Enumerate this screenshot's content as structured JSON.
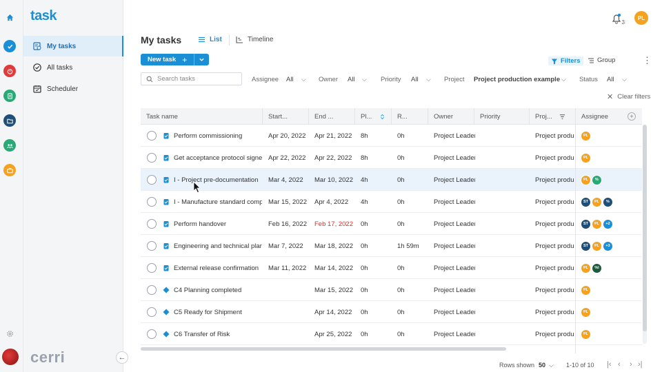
{
  "app": {
    "logo": "task",
    "brand": "cerri"
  },
  "rail": {
    "icons": [
      "home-icon",
      "check-circle-icon",
      "timer-icon",
      "document-icon",
      "folder-icon",
      "team-icon",
      "briefcase-icon",
      "settings-icon"
    ]
  },
  "sidebar": {
    "items": [
      {
        "label": "My tasks",
        "icon": "my-tasks-icon",
        "active": true
      },
      {
        "label": "All tasks",
        "icon": "check-circle-icon",
        "active": false
      },
      {
        "label": "Scheduler",
        "icon": "calendar-icon",
        "active": false
      }
    ],
    "collapse_icon": "←"
  },
  "header": {
    "title": "My tasks",
    "tabs": [
      {
        "label": "List",
        "active": true
      },
      {
        "label": "Timeline",
        "active": false
      }
    ],
    "notification_count": "3",
    "user_initials": "PL",
    "new_task_label": "New task",
    "new_task_plus": "+",
    "filters_label": "Filters",
    "group_label": "Group",
    "more_icon": "⋮"
  },
  "filters": {
    "search_placeholder": "Search tasks",
    "assignee": {
      "label": "Assignee",
      "value": "All"
    },
    "owner": {
      "label": "Owner",
      "value": "All"
    },
    "priority": {
      "label": "Priority",
      "value": "All"
    },
    "project": {
      "label": "Project",
      "value": "Project production example"
    },
    "status": {
      "label": "Status",
      "value": "All"
    },
    "clear_label": "Clear filters",
    "clear_icon": "✕",
    "chevron": "⌵"
  },
  "table": {
    "columns": [
      "Task name",
      "Start...",
      "End ...",
      "Pl...",
      "R...",
      "Owner",
      "Priority",
      "Proj...",
      "Assignee"
    ],
    "rows": [
      {
        "type": "task",
        "name": "Perform commissioning",
        "start": "Apr 20, 2022",
        "end": "Apr 21, 2022",
        "end_red": false,
        "planned": "8h",
        "remaining": "0h",
        "owner": "Project Leader",
        "priority": "",
        "project": "Project production example",
        "assignees": [
          {
            "i": "PL",
            "c": "#f4a21f"
          }
        ]
      },
      {
        "type": "task",
        "name": "Get acceptance protocol signed",
        "start": "Apr 22, 2022",
        "end": "Apr 22, 2022",
        "end_red": false,
        "planned": "8h",
        "remaining": "0h",
        "owner": "Project Leader",
        "priority": "",
        "project": "Project production example",
        "assignees": [
          {
            "i": "PL",
            "c": "#f4a21f"
          }
        ]
      },
      {
        "type": "task",
        "name": "I - Project pre-documentation",
        "start": "Mar 4, 2022",
        "end": "Mar 10, 2022",
        "end_red": false,
        "planned": "4h",
        "remaining": "0h",
        "owner": "Project Leader",
        "priority": "",
        "project": "Project production example",
        "assignees": [
          {
            "i": "PL",
            "c": "#f4a21f"
          },
          {
            "i": "%",
            "c": "#2aa876"
          }
        ]
      },
      {
        "type": "task",
        "name": "I - Manufacture standard components",
        "start": "Mar 15, 2022",
        "end": "Apr 4, 2022",
        "end_red": false,
        "planned": "4h",
        "remaining": "0h",
        "owner": "Project Leader",
        "priority": "",
        "project": "Project production example",
        "assignees": [
          {
            "i": "ST",
            "c": "#1f4e79"
          },
          {
            "i": "PL",
            "c": "#f4a21f"
          },
          {
            "i": "%",
            "c": "#1f4e79"
          }
        ]
      },
      {
        "type": "task",
        "name": "Perform handover",
        "start": "Feb 16, 2022",
        "end": "Feb 17, 2022",
        "end_red": true,
        "planned": "0h",
        "remaining": "0h",
        "owner": "Project Leader",
        "priority": "",
        "project": "Project production example",
        "assignees": [
          {
            "i": "ST",
            "c": "#1f4e79"
          },
          {
            "i": "PL",
            "c": "#f4a21f"
          },
          {
            "i": "+2",
            "c": "#1a8fd6"
          }
        ]
      },
      {
        "type": "task",
        "name": "Engineering and technical planning",
        "start": "Mar 7, 2022",
        "end": "Mar 18, 2022",
        "end_red": false,
        "planned": "0h",
        "remaining": "1h 59m",
        "owner": "Project Leader",
        "priority": "",
        "project": "Project production example",
        "assignees": [
          {
            "i": "ST",
            "c": "#1f4e79"
          },
          {
            "i": "PL",
            "c": "#f4a21f"
          },
          {
            "i": "+3",
            "c": "#1a8fd6"
          }
        ]
      },
      {
        "type": "task",
        "name": "External release confirmation",
        "start": "Mar 11, 2022",
        "end": "Mar 14, 2022",
        "end_red": false,
        "planned": "0h",
        "remaining": "0h",
        "owner": "Project Leader",
        "priority": "",
        "project": "Project production example",
        "assignees": [
          {
            "i": "PL",
            "c": "#f4a21f"
          },
          {
            "i": "%I",
            "c": "#1e5a3c"
          }
        ]
      },
      {
        "type": "milestone",
        "name": "C4 Planning completed",
        "start": "",
        "end": "Mar 15, 2022",
        "end_red": false,
        "planned": "0h",
        "remaining": "0h",
        "owner": "Project Leader",
        "priority": "",
        "project": "Project production example",
        "assignees": [
          {
            "i": "PL",
            "c": "#f4a21f"
          }
        ]
      },
      {
        "type": "milestone",
        "name": "C5 Ready for Shipment",
        "start": "",
        "end": "Apr 14, 2022",
        "end_red": false,
        "planned": "0h",
        "remaining": "0h",
        "owner": "Project Leader",
        "priority": "",
        "project": "Project production example",
        "assignees": [
          {
            "i": "PL",
            "c": "#f4a21f"
          }
        ]
      },
      {
        "type": "milestone",
        "name": "C6 Transfer of Risk",
        "start": "",
        "end": "Apr 25, 2022",
        "end_red": false,
        "planned": "0h",
        "remaining": "0h",
        "owner": "Project Leader",
        "priority": "",
        "project": "Project production example",
        "assignees": [
          {
            "i": "PL",
            "c": "#f4a21f"
          }
        ]
      }
    ],
    "highlighted_row": 2
  },
  "pagination": {
    "rows_shown_label": "Rows shown",
    "rows_shown_value": "50",
    "range": "1-10 of 10",
    "nav": [
      "|‹",
      "‹",
      "›",
      "›|"
    ]
  },
  "colors": {
    "accent": "#1a8fd6",
    "overdue": "#d0342c",
    "highlight": "#eaf3fb"
  }
}
